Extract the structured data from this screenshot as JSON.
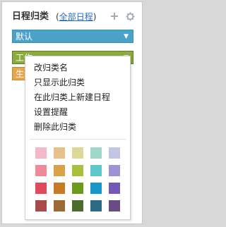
{
  "header": {
    "title": "日程归类",
    "open_paren": "(",
    "all_link": "全部日程",
    "close_paren": ")",
    "add_icon": "plus-icon",
    "settings_icon": "gear-icon"
  },
  "categories": [
    {
      "label": "默认",
      "color": "#4aa2c8"
    },
    {
      "label": "工作",
      "color": "#8aac3c"
    },
    {
      "label": "生活",
      "color": "#e6a64a"
    }
  ],
  "context_menu": {
    "items": [
      "改归类名",
      "只显示此归类",
      "在此归类上新建日程",
      "设置提醒",
      "删除此归类"
    ],
    "palette": [
      [
        "#f4b8c8",
        "#e8c08a",
        "#dcd896",
        "#9ed8c8",
        "#c4c4e4"
      ],
      [
        "#f08a98",
        "#d8a24a",
        "#a8c040",
        "#5cc8c8",
        "#9c94d4"
      ],
      [
        "#e04a5a",
        "#c87a24",
        "#6c9a1c",
        "#1898c8",
        "#7458b8"
      ],
      [
        "#a84a4a",
        "#9c6a34",
        "#4c6c2c",
        "#2c6a84",
        "#684c84"
      ]
    ]
  }
}
